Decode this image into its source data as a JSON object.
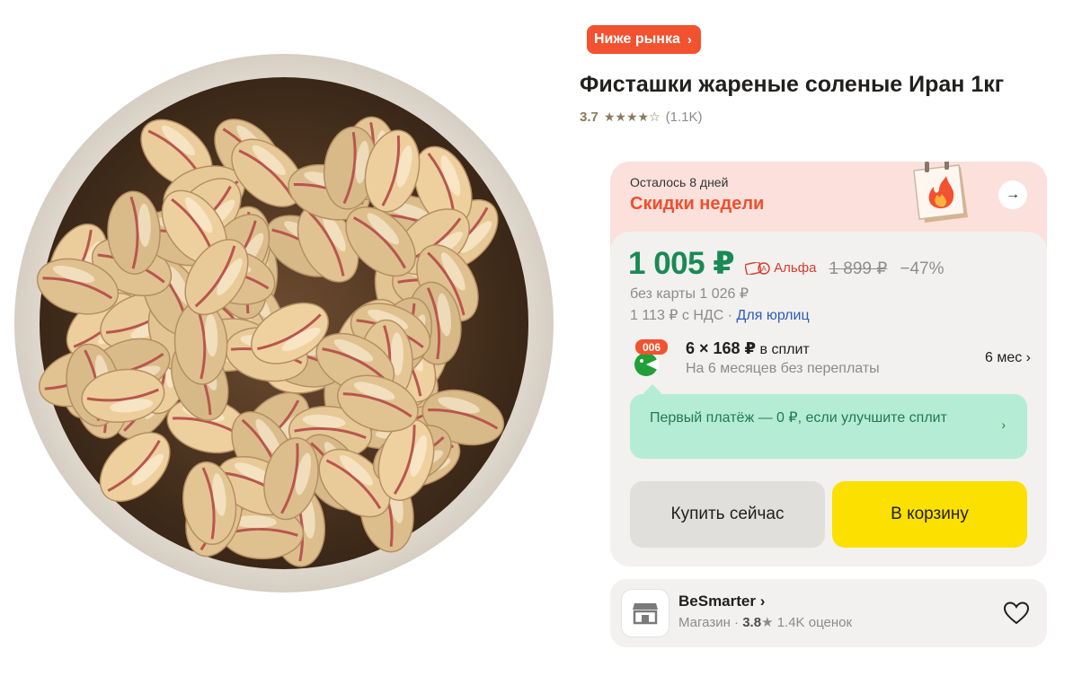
{
  "product": {
    "badge": "Ниже рынка",
    "title": "Фисташки жареные соленые Иран 1кг",
    "rating": {
      "score": "3.7",
      "stars": "★★★★☆",
      "count": "(1.1K)"
    }
  },
  "promo": {
    "days_left": "Осталось 8 дней",
    "name": "Скидки недели"
  },
  "pricing": {
    "price": "1 005 ₽",
    "bank_label": "Альфа",
    "old_price": "1 899 ₽",
    "discount": "−47%",
    "no_card": "без карты 1 026 ₽",
    "vat_text": "1 113 ₽ с НДС · ",
    "vat_link": "Для юрлиц"
  },
  "split": {
    "badge": "006",
    "main": "6 × 168 ₽",
    "main_suffix": " в сплит",
    "sub": "На 6 месяцев без переплаты",
    "months": "6 мес"
  },
  "first_payment": {
    "text": "Первый платёж — 0 ₽, если улучшите сплит"
  },
  "buttons": {
    "buy_now": "Купить сейчас",
    "to_cart": "В корзину"
  },
  "shop": {
    "name": "BeSmarter",
    "type": "Магазин",
    "rating": "3.8",
    "reviews": "1.4K оценок"
  },
  "colors": {
    "accent_red": "#f2522f",
    "price_green": "#1a8a55",
    "cart_yellow": "#fce000",
    "split_green_bg": "#b5ecd5"
  }
}
